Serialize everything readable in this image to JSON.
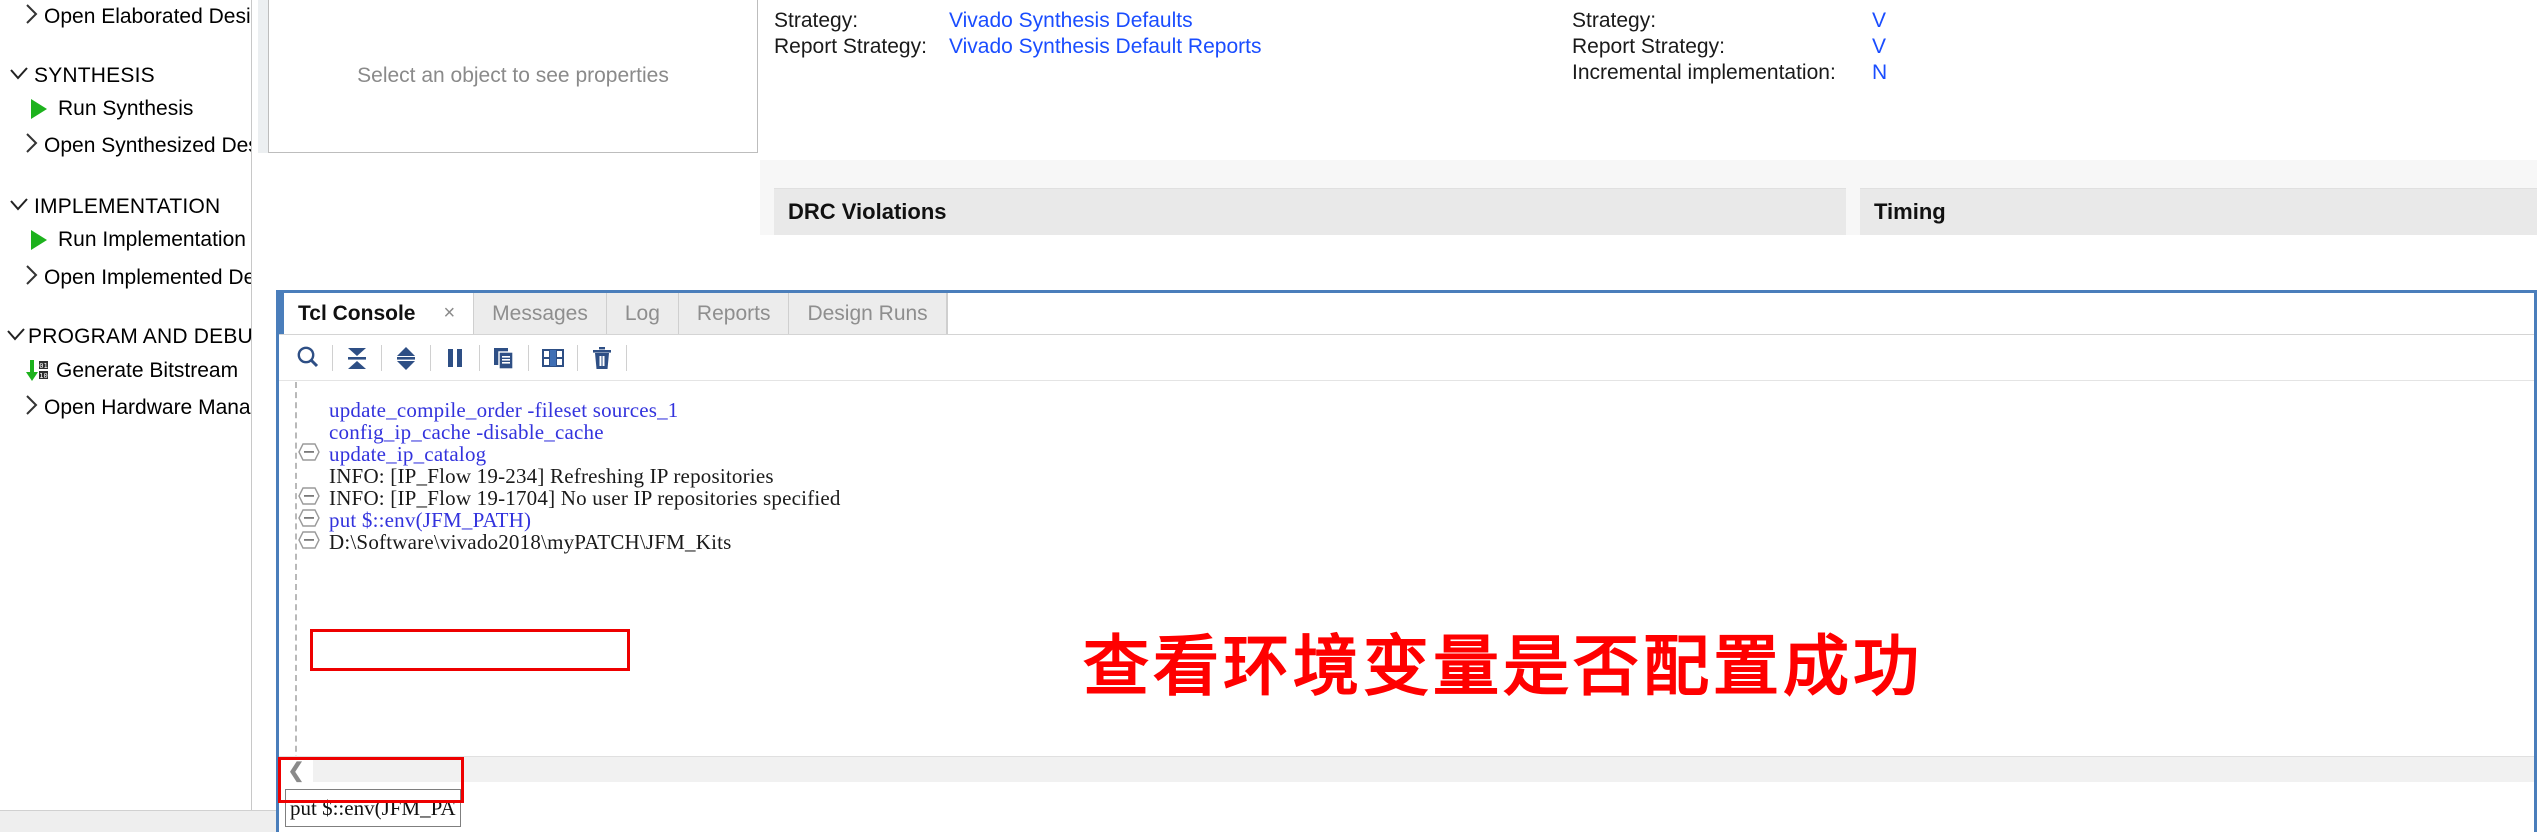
{
  "flow_navigator": {
    "rows": [
      {
        "kind": "item",
        "icon": "chevron-right-icon",
        "label": "Open Elaborated Design"
      },
      {
        "kind": "section",
        "icon": "chevron-down-icon",
        "label": "SYNTHESIS"
      },
      {
        "kind": "run",
        "icon": "play-icon",
        "label": "Run Synthesis"
      },
      {
        "kind": "item",
        "icon": "chevron-right-icon",
        "label": "Open Synthesized Design"
      },
      {
        "kind": "section",
        "icon": "chevron-down-icon",
        "label": "IMPLEMENTATION"
      },
      {
        "kind": "run",
        "icon": "play-icon",
        "label": "Run Implementation"
      },
      {
        "kind": "item",
        "icon": "chevron-right-icon",
        "label": "Open Implemented Design"
      },
      {
        "kind": "section",
        "icon": "chevron-down-icon",
        "label": "PROGRAM AND DEBUG"
      },
      {
        "kind": "bits",
        "icon": "generate-bitstream-icon",
        "label": "Generate Bitstream"
      },
      {
        "kind": "item",
        "icon": "chevron-right-icon",
        "label": "Open Hardware Manager"
      }
    ]
  },
  "properties_panel": {
    "placeholder": "Select an object to see properties"
  },
  "summary": {
    "synthesis": {
      "rows": [
        {
          "key": "Strategy:",
          "value": "Vivado Synthesis Defaults",
          "link": true
        },
        {
          "key": "Report Strategy:",
          "value": "Vivado Synthesis Default Reports",
          "link": true
        }
      ],
      "section_header": "DRC Violations"
    },
    "implementation": {
      "rows": [
        {
          "key": "Strategy:",
          "value": "V",
          "link": true
        },
        {
          "key": "Report Strategy:",
          "value": "V",
          "link": true
        },
        {
          "key": "Incremental implementation:",
          "value": "N",
          "link": true
        }
      ],
      "section_header": "Timing"
    }
  },
  "console": {
    "tabs": [
      {
        "label": "Tcl Console",
        "active": true,
        "closable": true
      },
      {
        "label": "Messages",
        "active": false,
        "closable": false
      },
      {
        "label": "Log",
        "active": false,
        "closable": false
      },
      {
        "label": "Reports",
        "active": false,
        "closable": false
      },
      {
        "label": "Design Runs",
        "active": false,
        "closable": false
      }
    ],
    "close_glyph": "×",
    "toolbar": [
      {
        "name": "search-icon",
        "title": "Search"
      },
      {
        "name": "collapse-all-icon",
        "title": "Collapse All"
      },
      {
        "name": "expand-all-icon",
        "title": "Expand All"
      },
      {
        "name": "pause-icon",
        "title": "Pause"
      },
      {
        "name": "copy-icon",
        "title": "Copy"
      },
      {
        "name": "open-new-window-icon",
        "title": "Open in New Window"
      },
      {
        "name": "trash-icon",
        "title": "Clear Console"
      }
    ],
    "output_lines": [
      {
        "text": "update_compile_order -fileset sources_1",
        "type": "cmd",
        "fold": "none"
      },
      {
        "text": "config_ip_cache -disable_cache",
        "type": "cmd",
        "fold": "none"
      },
      {
        "text": "update_ip_catalog",
        "type": "cmd",
        "fold": "collapse-down"
      },
      {
        "text": "INFO: [IP_Flow 19-234] Refreshing IP repositories",
        "type": "info",
        "fold": "none"
      },
      {
        "text": "INFO: [IP_Flow 19-1704] No user IP repositories specified",
        "type": "info",
        "fold": "collapse-up"
      },
      {
        "text": "put $::env(JFM_PATH)",
        "type": "cmd",
        "fold": "collapse-down"
      },
      {
        "text": "D:\\Software\\vivado2018\\myPATCH\\JFM_Kits",
        "type": "result",
        "fold": "collapse-up"
      }
    ],
    "scroll_left_glyph": "❮",
    "input_value": "put $::env(JFM_PATH)"
  },
  "annotation": {
    "note_text": "查看环境变量是否配置成功",
    "note_color": "#ff0000",
    "highlight_color": "#ee0000"
  },
  "colors": {
    "link": "#1a4dff",
    "accent": "#4a7ebb",
    "console_cmd": "#3333dd",
    "play_green": "#1db21d",
    "section_header_bg": "#e9e9e9"
  }
}
